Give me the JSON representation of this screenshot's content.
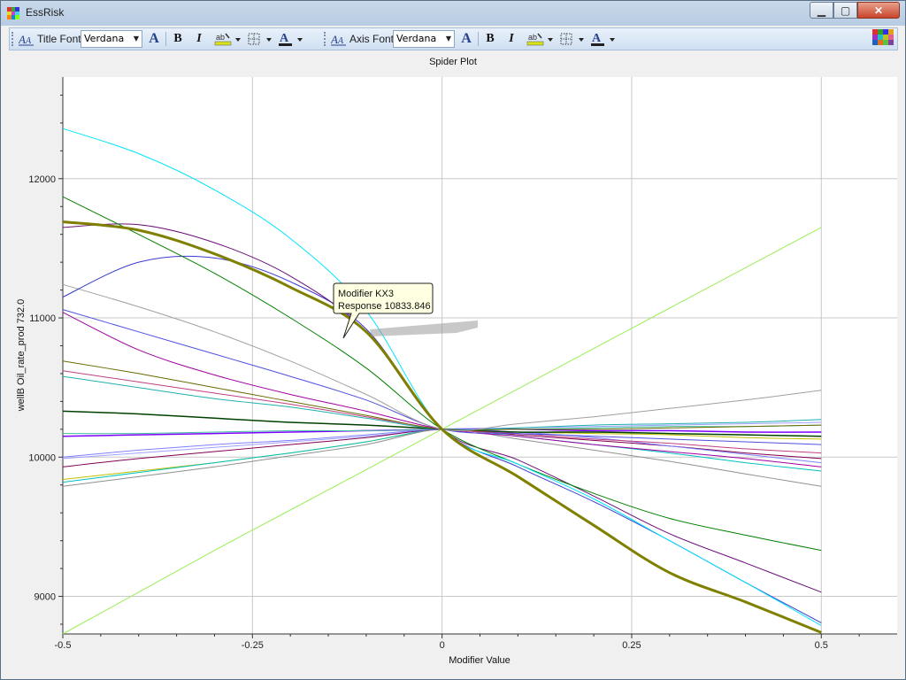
{
  "window": {
    "title": "EssRisk"
  },
  "window_buttons": {
    "minimize": "▁",
    "maximize": "▢",
    "close": "✕"
  },
  "toolbar": {
    "title_font": {
      "label": "Title Font",
      "value": "Verdana"
    },
    "axis_font": {
      "label": "Axis Font",
      "value": "Verdana"
    },
    "bold_label": "B",
    "italic_label": "I",
    "font_color_label": "A",
    "increase_font_label": "A"
  },
  "tooltip": {
    "line1": "Modifier KX3",
    "line2": "Response 10833.846"
  },
  "chart_data": {
    "type": "line",
    "title": "Spider Plot",
    "xlabel": "Modifier Value",
    "ylabel": "wellB Oil_rate_prod 732.0",
    "xlim": [
      -0.5,
      0.6
    ],
    "ylim": [
      8730,
      12730
    ],
    "xticks": [
      -0.5,
      -0.25,
      0,
      0.25,
      0.5
    ],
    "xtick_labels": [
      "-0.5",
      "-0.25",
      "0",
      "0.25",
      "0.5"
    ],
    "yticks": [
      9000,
      10000,
      11000,
      12000
    ],
    "ytick_labels": [
      "9000",
      "10000",
      "11000",
      "12000"
    ],
    "grid": true,
    "x": [
      -0.5,
      -0.4,
      -0.3,
      -0.2,
      -0.1,
      0,
      0.1,
      0.2,
      0.3,
      0.4,
      0.5
    ],
    "series": [
      {
        "color": "#808000",
        "width": 3,
        "values": [
          11690,
          11630,
          11460,
          11220,
          10900,
          10200,
          9860,
          9510,
          9170,
          8960,
          8740
        ]
      },
      {
        "color": "#00e5ff",
        "width": 1,
        "values": [
          12360,
          12180,
          11920,
          11570,
          11050,
          10200,
          9950,
          9700,
          9400,
          9100,
          8790
        ]
      },
      {
        "color": "#008000",
        "width": 1,
        "values": [
          11870,
          11600,
          11320,
          11000,
          10640,
          10200,
          9950,
          9740,
          9560,
          9440,
          9330
        ]
      },
      {
        "color": "#6b0f7a",
        "width": 1,
        "values": [
          11650,
          11670,
          11540,
          11300,
          10900,
          10200,
          9980,
          9720,
          9450,
          9240,
          9030
        ]
      },
      {
        "color": "#3a3ad0",
        "width": 1,
        "values": [
          11150,
          11400,
          11430,
          11260,
          10920,
          10200,
          9930,
          9680,
          9400,
          9100,
          8810
        ]
      },
      {
        "color": "#a0a0a0",
        "width": 1,
        "values": [
          11240,
          11080,
          10900,
          10690,
          10450,
          10200,
          10240,
          10290,
          10350,
          10410,
          10480
        ]
      },
      {
        "color": "#5050e0",
        "width": 1,
        "values": [
          11060,
          10900,
          10740,
          10580,
          10410,
          10200,
          10170,
          10150,
          10130,
          10110,
          10090
        ]
      },
      {
        "color": "#a000a0",
        "width": 1,
        "values": [
          11040,
          10770,
          10590,
          10450,
          10330,
          10200,
          10150,
          10090,
          10040,
          9990,
          9930
        ]
      },
      {
        "color": "#6a6a00",
        "width": 1,
        "values": [
          10690,
          10600,
          10500,
          10400,
          10300,
          10200,
          10200,
          10200,
          10210,
          10220,
          10230
        ]
      },
      {
        "color": "#c04080",
        "width": 1,
        "values": [
          10620,
          10540,
          10460,
          10380,
          10290,
          10200,
          10170,
          10130,
          10100,
          10060,
          10030
        ]
      },
      {
        "color": "#20b0b0",
        "width": 1,
        "values": [
          10580,
          10500,
          10420,
          10360,
          10280,
          10200,
          10210,
          10230,
          10240,
          10250,
          10270
        ]
      },
      {
        "color": "#004000",
        "width": 1.5,
        "values": [
          10330,
          10310,
          10280,
          10250,
          10230,
          10200,
          10180,
          10180,
          10170,
          10160,
          10150
        ]
      },
      {
        "color": "#8080ff",
        "width": 1,
        "values": [
          10000,
          10050,
          10090,
          10120,
          10160,
          10200,
          10180,
          10140,
          10080,
          10020,
          9960
        ]
      },
      {
        "color": "#40c0a0",
        "width": 1,
        "values": [
          10170,
          10170,
          10180,
          10190,
          10190,
          10200,
          10200,
          10210,
          10220,
          10220,
          10230
        ]
      },
      {
        "color": "#8000ff",
        "width": 1.5,
        "values": [
          10150,
          10160,
          10170,
          10180,
          10190,
          10200,
          10200,
          10190,
          10190,
          10180,
          10180
        ]
      },
      {
        "color": "#800050",
        "width": 1,
        "values": [
          9930,
          9990,
          10040,
          10090,
          10140,
          10200,
          10160,
          10120,
          10080,
          10030,
          9990
        ]
      },
      {
        "color": "#909090",
        "width": 1,
        "values": [
          9790,
          9860,
          9930,
          10010,
          10090,
          10200,
          10130,
          10050,
          9970,
          9880,
          9790
        ]
      },
      {
        "color": "#00c0c0",
        "width": 1,
        "values": [
          9820,
          9890,
          9960,
          10030,
          10110,
          10200,
          10150,
          10090,
          10030,
          9960,
          9900
        ]
      },
      {
        "color": "#c0c000",
        "width": 1,
        "values": [
          9840,
          9900,
          9960,
          10030,
          10110,
          10200,
          10180,
          10170,
          10160,
          10140,
          10130
        ]
      },
      {
        "color": "#a0a0ff",
        "width": 1,
        "values": [
          9990,
          10030,
          10070,
          10110,
          10150,
          10200,
          10210,
          10220,
          10230,
          10240,
          10250
        ]
      },
      {
        "color": "#99ee55",
        "width": 1,
        "values": [
          8730,
          9030,
          9330,
          9620,
          9910,
          10200,
          10490,
          10780,
          11070,
          11360,
          11650
        ]
      }
    ]
  }
}
